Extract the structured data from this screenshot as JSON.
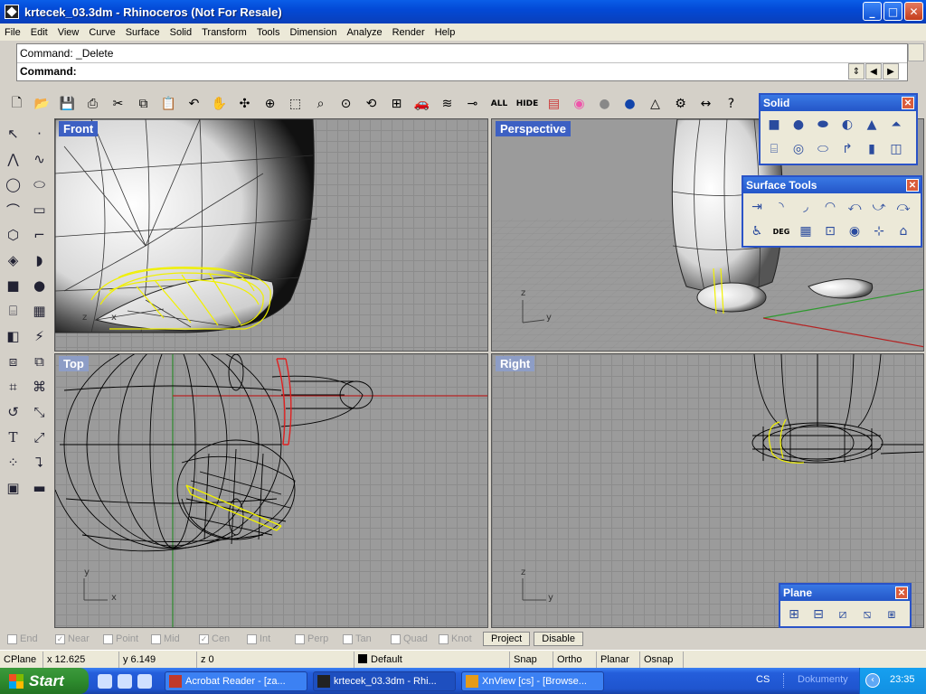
{
  "window": {
    "title": "krtecek_03.3dm - Rhinoceros (Not For Resale)",
    "btn_min": "_",
    "btn_max": "□",
    "btn_close": "✕"
  },
  "menu": [
    "File",
    "Edit",
    "View",
    "Curve",
    "Surface",
    "Solid",
    "Transform",
    "Tools",
    "Dimension",
    "Analyze",
    "Render",
    "Help"
  ],
  "command": {
    "history": "Command: _Delete",
    "prompt": "Command:"
  },
  "toolbar": {
    "all_label": "ALL",
    "hide_label": "HIDE"
  },
  "viewports": {
    "front": "Front",
    "perspective": "Perspective",
    "top": "Top",
    "right": "Right"
  },
  "axes": {
    "x": "x",
    "y": "y",
    "z": "z"
  },
  "panels": {
    "solid": "Solid",
    "surface_tools": "Surface Tools",
    "plane": "Plane",
    "deg_label": "DEG"
  },
  "osnap": {
    "items": [
      {
        "label": "End",
        "checked": false
      },
      {
        "label": "Near",
        "checked": true
      },
      {
        "label": "Point",
        "checked": false
      },
      {
        "label": "Mid",
        "checked": false
      },
      {
        "label": "Cen",
        "checked": true
      },
      {
        "label": "Int",
        "checked": false
      },
      {
        "label": "Perp",
        "checked": false
      },
      {
        "label": "Tan",
        "checked": false
      },
      {
        "label": "Quad",
        "checked": false
      },
      {
        "label": "Knot",
        "checked": false
      }
    ],
    "project": "Project",
    "disable": "Disable"
  },
  "status": {
    "cplane": "CPlane",
    "x": "x 12.625",
    "y": "y 6.149",
    "z": "z 0",
    "layer": "Default",
    "snap": "Snap",
    "ortho": "Ortho",
    "planar": "Planar",
    "osnap": "Osnap"
  },
  "taskbar": {
    "start": "Start",
    "tasks": [
      "Acrobat Reader - [za...",
      "krtecek_03.3dm - Rhi...",
      "XnView [cs] - [Browse..."
    ],
    "lang": "CS",
    "dokumenty": "Dokumenty",
    "time": "23:35"
  },
  "colors": {
    "selection_yellow": "#f0f000",
    "curve_red": "#e02020",
    "title_blue": "#0a5ee8",
    "viewport_bg": "#9b9b9b"
  }
}
